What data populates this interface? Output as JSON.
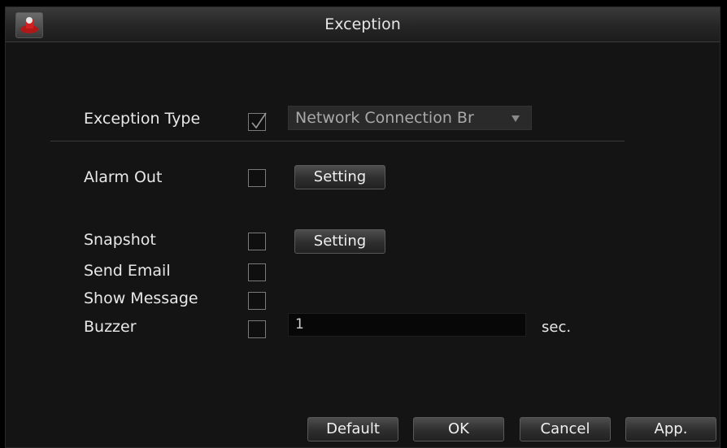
{
  "window": {
    "title": "Exception"
  },
  "exception_type": {
    "label": "Exception Type",
    "checked": true,
    "selected": "Network Connection Br"
  },
  "alarm_out": {
    "label": "Alarm Out",
    "checked": false,
    "button": "Setting"
  },
  "snapshot": {
    "label": "Snapshot",
    "checked": false,
    "button": "Setting"
  },
  "send_email": {
    "label": "Send Email",
    "checked": false
  },
  "show_message": {
    "label": "Show Message",
    "checked": false
  },
  "buzzer": {
    "label": "Buzzer",
    "checked": false,
    "value": "1",
    "unit": "sec."
  },
  "footer": {
    "default": "Default",
    "ok": "OK",
    "cancel": "Cancel",
    "apply": "App."
  },
  "icons": {
    "app": "app-logo-icon",
    "dropdown": "chevron-down-icon",
    "check": "checkmark-icon"
  }
}
